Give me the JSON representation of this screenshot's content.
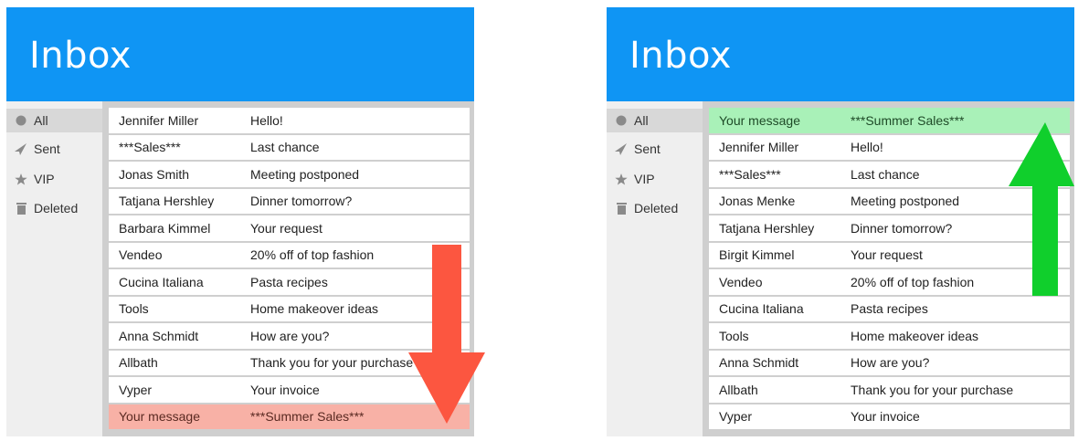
{
  "colors": {
    "header": "#0f95f4",
    "highlight_old": "#f8b1a6",
    "highlight_new": "#a9f1b8",
    "arrow_down": "#fc5640",
    "arrow_up": "#10cf2c"
  },
  "left": {
    "title": "Inbox",
    "sidebar": [
      {
        "icon": "circle-icon",
        "label": "All"
      },
      {
        "icon": "send-icon",
        "label": "Sent"
      },
      {
        "icon": "star-icon",
        "label": "VIP"
      },
      {
        "icon": "trash-icon",
        "label": "Deleted"
      }
    ],
    "rows": [
      {
        "sender": "Jennifer Miller",
        "subject": "Hello!"
      },
      {
        "sender": "***Sales***",
        "subject": "Last chance"
      },
      {
        "sender": "Jonas Smith",
        "subject": "Meeting postponed"
      },
      {
        "sender": "Tatjana Hershley",
        "subject": "Dinner tomorrow?"
      },
      {
        "sender": "Barbara Kimmel",
        "subject": "Your request"
      },
      {
        "sender": "Vendeo",
        "subject": "20% off of top fashion"
      },
      {
        "sender": "Cucina Italiana",
        "subject": "Pasta recipes"
      },
      {
        "sender": "Tools",
        "subject": "Home makeover ideas"
      },
      {
        "sender": "Anna Schmidt",
        "subject": "How are you?"
      },
      {
        "sender": "Allbath",
        "subject": "Thank you for your purchase"
      },
      {
        "sender": "Vyper",
        "subject": "Your invoice"
      },
      {
        "sender": "Your message",
        "subject": "***Summer Sales***"
      }
    ]
  },
  "right": {
    "title": "Inbox",
    "sidebar": [
      {
        "icon": "circle-icon",
        "label": "All"
      },
      {
        "icon": "send-icon",
        "label": "Sent"
      },
      {
        "icon": "star-icon",
        "label": "VIP"
      },
      {
        "icon": "trash-icon",
        "label": "Deleted"
      }
    ],
    "rows": [
      {
        "sender": "Your message",
        "subject": "***Summer Sales***"
      },
      {
        "sender": "Jennifer Miller",
        "subject": "Hello!"
      },
      {
        "sender": "***Sales***",
        "subject": "Last chance"
      },
      {
        "sender": "Jonas Menke",
        "subject": "Meeting postponed"
      },
      {
        "sender": "Tatjana Hershley",
        "subject": "Dinner tomorrow?"
      },
      {
        "sender": "Birgit Kimmel",
        "subject": "Your request"
      },
      {
        "sender": "Vendeo",
        "subject": "20% off of top fashion"
      },
      {
        "sender": "Cucina Italiana",
        "subject": "Pasta recipes"
      },
      {
        "sender": "Tools",
        "subject": "Home makeover ideas"
      },
      {
        "sender": "Anna Schmidt",
        "subject": "How are you?"
      },
      {
        "sender": "Allbath",
        "subject": "Thank you for your purchase"
      },
      {
        "sender": "Vyper",
        "subject": "Your invoice"
      }
    ]
  }
}
